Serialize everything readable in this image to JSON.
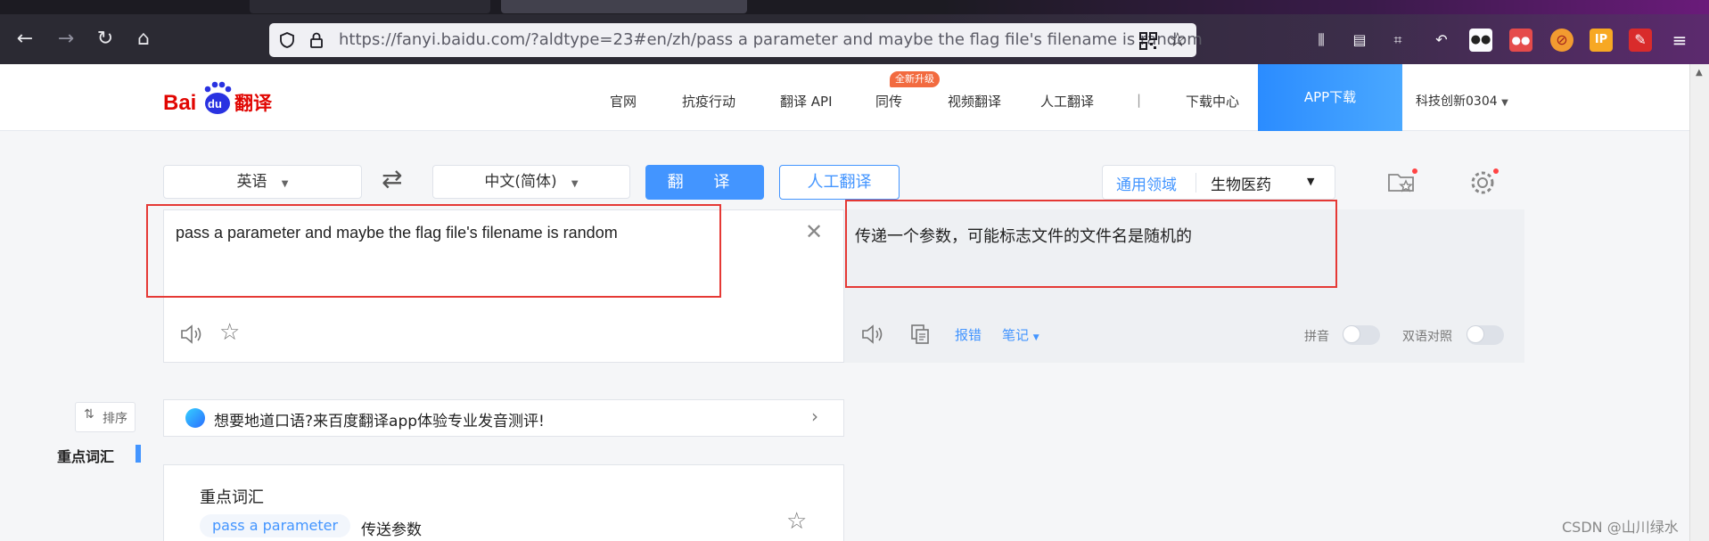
{
  "browser": {
    "url": "https://fanyi.baidu.com/?aldtype=23#en/zh/pass a parameter and maybe the flag file's filename is random",
    "toolbar_icons": [
      "library-icon",
      "sidebar-icon",
      "screenshot-icon",
      "undo-icon",
      "extension-icon",
      "extension-icon",
      "extension-icon",
      "ip-icon",
      "extension-icon",
      "menu-icon"
    ]
  },
  "site": {
    "logo_text_bai": "Bai",
    "logo_text_du": "du",
    "logo_text_fanyi": "翻译",
    "nav": [
      "官网",
      "抗疫行动",
      "翻译 API",
      "同传",
      "视频翻译",
      "人工翻译",
      "|",
      "下载中心"
    ],
    "nav_badge": "全新升级",
    "app_download": "APP下载",
    "user": "科技创新0304"
  },
  "controls": {
    "source_lang": "英语",
    "target_lang": "中文(简体)",
    "translate_btn": "翻 译",
    "human_btn": "人工翻译",
    "domain_general": "通用领域",
    "domain_selected": "生物医药"
  },
  "input": {
    "text": "pass a parameter and maybe the flag file's filename is random"
  },
  "output": {
    "text": "传递一个参数，可能标志文件的文件名是随机的",
    "report_label": "报错",
    "notes_label": "笔记",
    "pinyin_label": "拼音",
    "bilingual_label": "双语对照"
  },
  "lower": {
    "sort_label": "排序",
    "section_label": "重点词汇",
    "tip_text": "想要地道口语?来百度翻译app体验专业发音测评!",
    "vocab_title": "重点词汇",
    "vocab_term": "pass a parameter",
    "vocab_meaning": "传送参数"
  },
  "watermark": "CSDN @山川绿水",
  "colors": {
    "accent": "#4395ff",
    "brand_red": "#e10602",
    "highlight_red": "#e53935"
  }
}
